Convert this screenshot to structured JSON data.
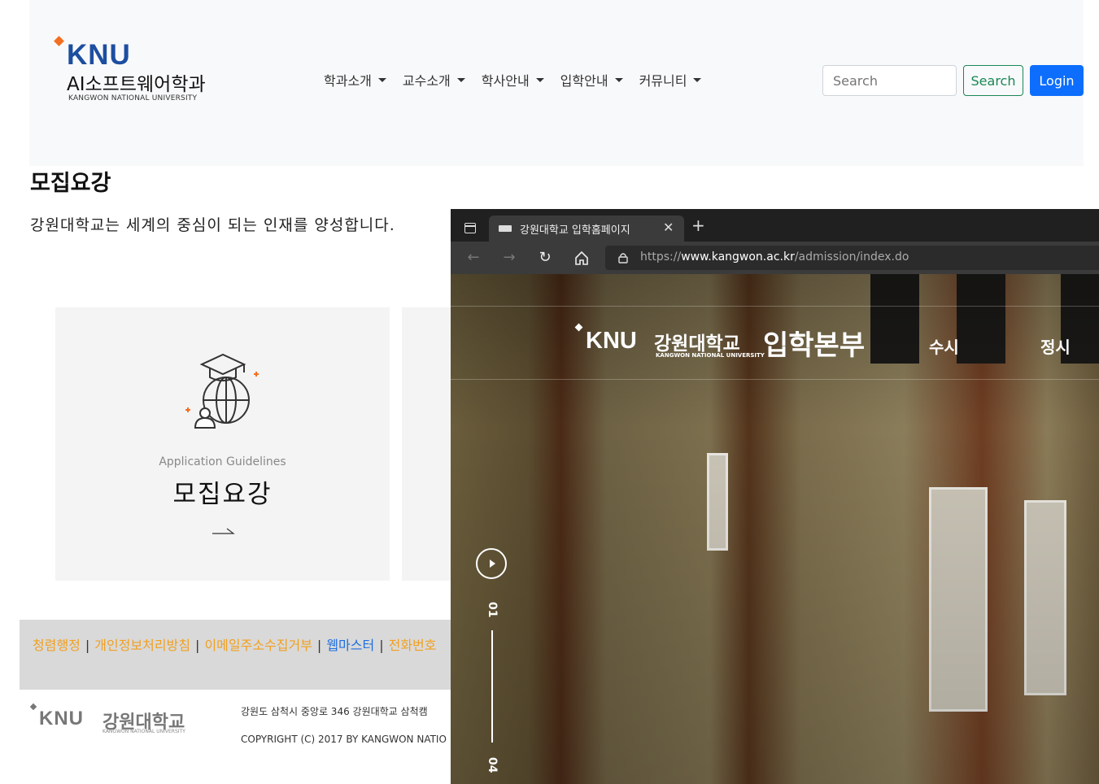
{
  "site": {
    "logo": {
      "mark": "KNU",
      "title": "AI소프트웨어학과",
      "sub": "KANGWON NATIONAL UNIVERSITY"
    },
    "nav": [
      {
        "label": "학과소개"
      },
      {
        "label": "교수소개"
      },
      {
        "label": "학사안내"
      },
      {
        "label": "입학안내"
      },
      {
        "label": "커뮤니티"
      }
    ],
    "search": {
      "placeholder": "Search",
      "button": "Search"
    },
    "login": "Login"
  },
  "main": {
    "title": "모집요강",
    "description": "강원대학교는 세계의 중심이 되는 인재를 양성합니다.",
    "cards": [
      {
        "label_en": "Application Guidelines",
        "label_ko": "모집요강"
      }
    ]
  },
  "footer": {
    "links": [
      {
        "label": "청렴행정"
      },
      {
        "label": "개인정보처리방침"
      },
      {
        "label": "이메일주소수집거부"
      },
      {
        "label": "웹마스터"
      },
      {
        "label": "전화번호"
      }
    ],
    "logo": {
      "mark": "KNU",
      "name": "강원대학교",
      "sub": "KANGWON NATIONAL UNIVERSITY"
    },
    "address": "강원도 삼척시 중앙로 346 강원대학교 삼척캠",
    "copyright": "COPYRIGHT (C) 2017 BY KANGWON NATIO"
  },
  "browser": {
    "tab_title": "강원대학교 입학홈페이지",
    "url_prefix": "https://",
    "url_host": "www.kangwon.ac.kr",
    "url_path": "/admission/index.do",
    "page": {
      "logo_mark": "KNU",
      "logo_name": "강원대학교",
      "logo_sub": "KANGWON NATIONAL UNIVERSITY",
      "logo_big": "입학본부",
      "menu": [
        {
          "label": "수시"
        },
        {
          "label": "정시"
        }
      ],
      "slide_current": "01",
      "slide_total": "04"
    }
  },
  "colors": {
    "brand_blue": "#1d4ea0",
    "brand_orange": "#f36f21",
    "search_green": "#198754",
    "login_blue": "#0d6efd",
    "footer_link": "#f0a020",
    "footer_link_active": "#1f6fe0"
  }
}
